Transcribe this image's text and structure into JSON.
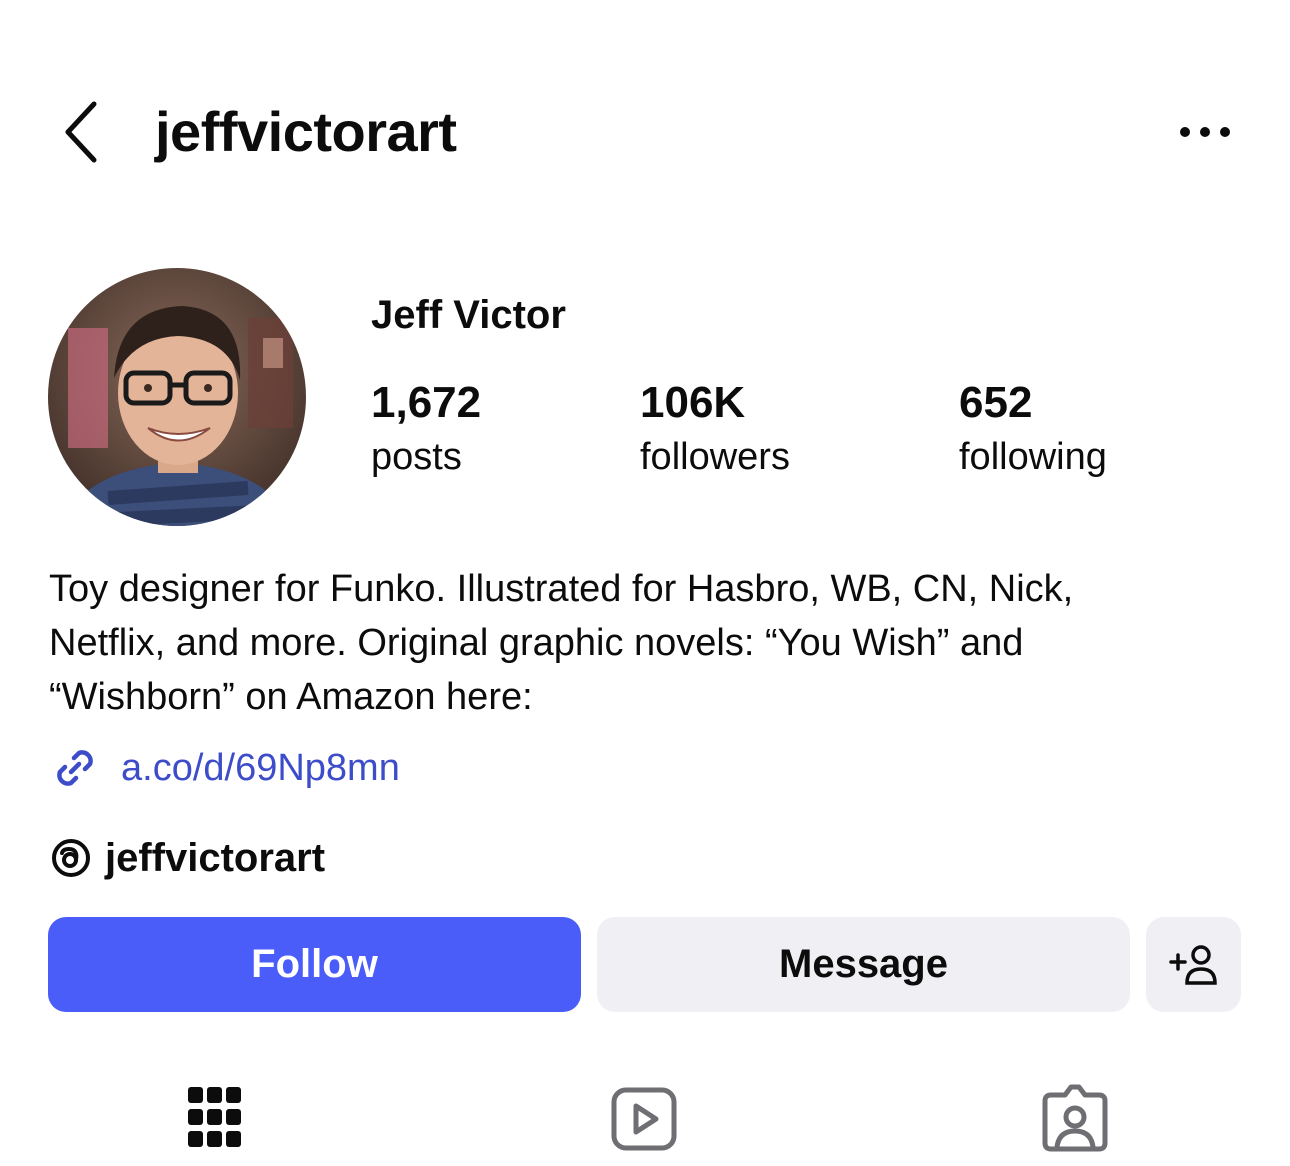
{
  "header": {
    "username": "jeffvictorart",
    "back_icon": "chevron-left-icon",
    "more_icon": "ellipsis-icon"
  },
  "profile": {
    "display_name": "Jeff Victor",
    "stats": [
      {
        "value": "1,672",
        "label": "posts"
      },
      {
        "value": "106K",
        "label": "followers"
      },
      {
        "value": "652",
        "label": "following"
      }
    ],
    "bio": {
      "line1": "Toy designer for Funko. Illustrated for Hasbro, WB, CN, Nick,",
      "line2": "Netflix, and more. Original graphic novels: “You Wish” and",
      "line3": "“Wishborn” on Amazon here:"
    },
    "link": "a.co/d/69Np8mn",
    "threads_handle": "jeffvictorart"
  },
  "actions": {
    "follow_label": "Follow",
    "message_label": "Message"
  },
  "tabs": [
    {
      "icon": "grid-icon"
    },
    {
      "icon": "reels-icon"
    },
    {
      "icon": "tagged-icon"
    }
  ],
  "colors": {
    "follow": "#4a5df9",
    "link": "#3d4cc9",
    "secondary_button": "#efeff4"
  }
}
